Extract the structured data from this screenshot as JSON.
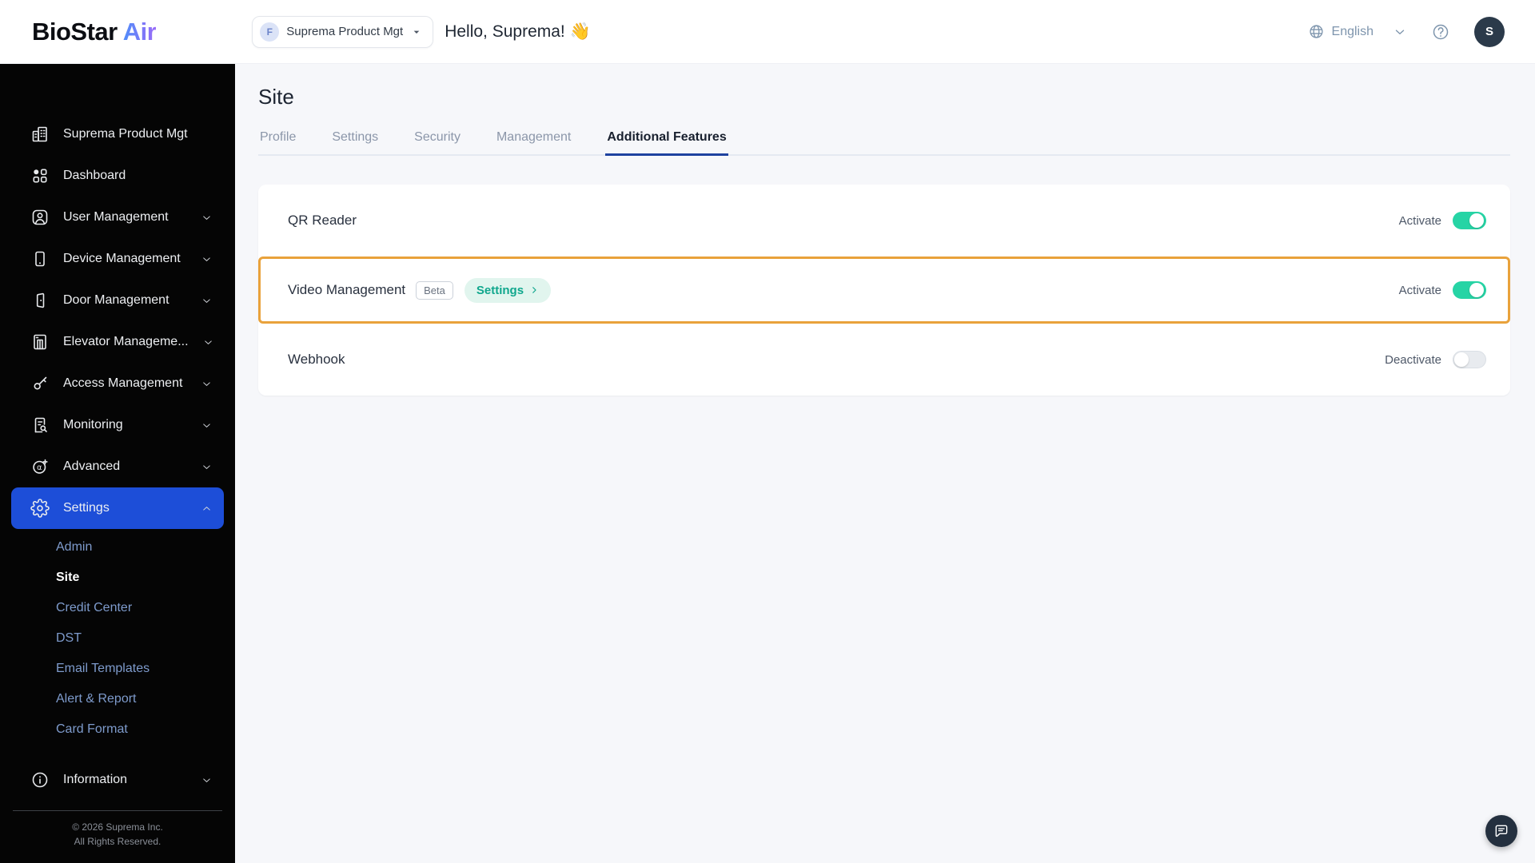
{
  "header": {
    "logo_biostar": "BioStar",
    "logo_air": "Air",
    "org_selector": {
      "badge": "F",
      "label": "Suprema Product Mgt"
    },
    "greeting": "Hello, Suprema! 👋",
    "language": "English",
    "avatar": "S"
  },
  "sidebar": {
    "items": [
      {
        "label": "Suprema Product Mgt",
        "icon": "building",
        "expandable": false
      },
      {
        "label": "Dashboard",
        "icon": "dashboard",
        "expandable": false
      },
      {
        "label": "User Management",
        "icon": "user",
        "expandable": true
      },
      {
        "label": "Device Management",
        "icon": "device",
        "expandable": true
      },
      {
        "label": "Door Management",
        "icon": "door",
        "expandable": true
      },
      {
        "label": "Elevator Manageme...",
        "icon": "elevator",
        "expandable": true
      },
      {
        "label": "Access Management",
        "icon": "key",
        "expandable": true
      },
      {
        "label": "Monitoring",
        "icon": "monitoring",
        "expandable": true
      },
      {
        "label": "Advanced",
        "icon": "advanced",
        "expandable": true
      },
      {
        "label": "Settings",
        "icon": "gear",
        "expandable": true,
        "active": true,
        "expanded": true,
        "children": [
          {
            "label": "Admin"
          },
          {
            "label": "Site",
            "active": true
          },
          {
            "label": "Credit Center"
          },
          {
            "label": "DST"
          },
          {
            "label": "Email Templates"
          },
          {
            "label": "Alert & Report"
          },
          {
            "label": "Card Format"
          }
        ]
      },
      {
        "label": "Information",
        "icon": "info",
        "expandable": true,
        "gap_top": true
      }
    ],
    "footer_line1": "© 2026 Suprema Inc.",
    "footer_line2": "All Rights Reserved."
  },
  "main": {
    "title": "Site",
    "tabs": [
      {
        "label": "Profile"
      },
      {
        "label": "Settings"
      },
      {
        "label": "Security"
      },
      {
        "label": "Management"
      },
      {
        "label": "Additional Features",
        "active": true
      }
    ],
    "features": [
      {
        "name": "QR Reader",
        "state_label": "Activate",
        "on": true
      },
      {
        "name": "Video Management",
        "badge": "Beta",
        "action_label": "Settings",
        "state_label": "Activate",
        "on": true,
        "highlighted": true
      },
      {
        "name": "Webhook",
        "state_label": "Deactivate",
        "on": false
      }
    ]
  },
  "colors": {
    "sidebar_active_blue": "#1d4ed8",
    "tab_underline_blue": "#1e429f",
    "highlight_orange": "#e9a23b",
    "toggle_on_teal": "#26d4a5",
    "settings_pill_bg": "#e1f5ee",
    "settings_pill_text": "#10a78d"
  }
}
